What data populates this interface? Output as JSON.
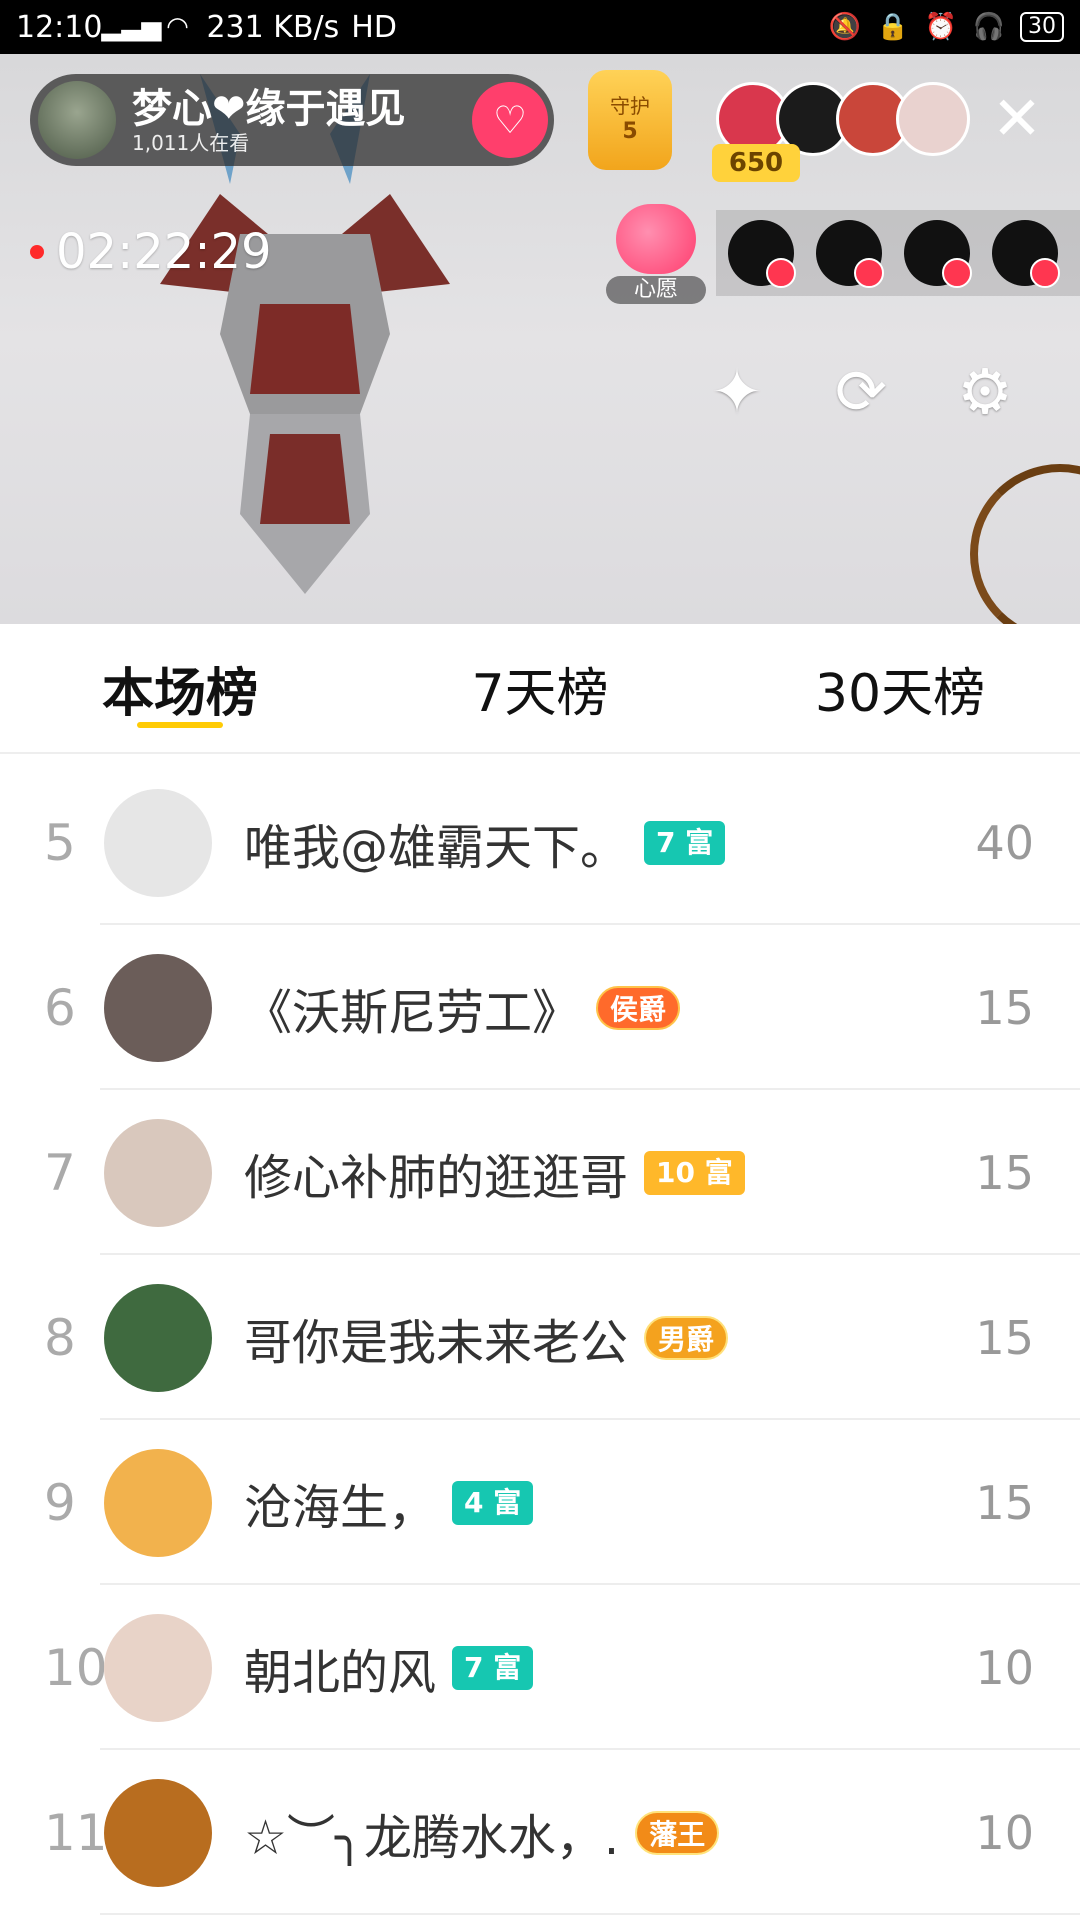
{
  "status_bar": {
    "time": "12:10",
    "network": "4G",
    "speed": "231 KB/s",
    "hd": "HD",
    "battery": "30"
  },
  "live": {
    "host_name": "梦心❤缘于遇见",
    "host_sub": "1,011人在看",
    "guard_label": "守护",
    "guard_count": "5",
    "viewer_count": "650",
    "timer": "02:22:29",
    "wish_label": "心愿"
  },
  "tabs": [
    {
      "label": "本场榜"
    },
    {
      "label": "7天榜"
    },
    {
      "label": "30天榜"
    }
  ],
  "ranking": [
    {
      "rank": "5",
      "name": "唯我@雄霸天下。",
      "badge": "7 富",
      "score": "40",
      "avatar_color": "#e6e6e6"
    },
    {
      "rank": "6",
      "name": "《沃斯尼劳工》",
      "badge": "侯爵",
      "score": "15",
      "avatar_color": "#6b5d59"
    },
    {
      "rank": "7",
      "name": "修心补肺的逛逛哥",
      "badge": "10 富",
      "score": "15",
      "avatar_color": "#d9c8bd"
    },
    {
      "rank": "8",
      "name": "哥你是我未来老公",
      "badge": "男爵",
      "score": "15",
      "avatar_color": "#3f6a3f"
    },
    {
      "rank": "9",
      "name": "沧海生，",
      "badge": "4 富",
      "score": "15",
      "avatar_color": "#f2b24d"
    },
    {
      "rank": "10",
      "name": "朝北的风",
      "badge": "7 富",
      "score": "10",
      "avatar_color": "#e8d3c8"
    },
    {
      "rank": "11",
      "name": "☆︶╮龙腾水水，.",
      "badge": "藩王",
      "score": "10",
      "avatar_color": "#b86d1f"
    }
  ]
}
